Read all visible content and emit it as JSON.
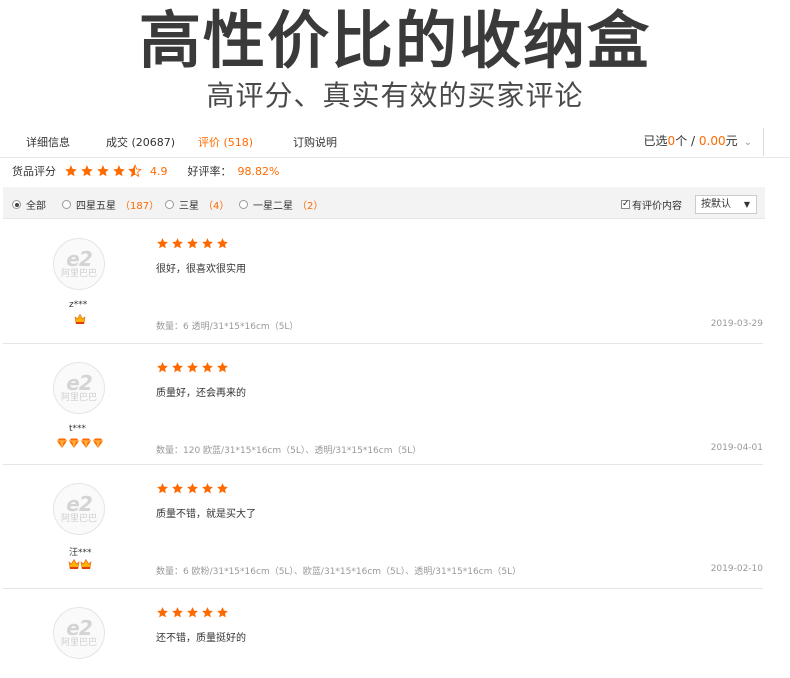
{
  "banner": {
    "title": "高性价比的收纳盒",
    "subtitle": "高评分、真实有效的买家评论"
  },
  "tabs": [
    {
      "label": "详细信息",
      "active": false
    },
    {
      "label": "成交 (20687)",
      "active": false
    },
    {
      "label": "评价 (518)",
      "active": true
    },
    {
      "label": "订购说明",
      "active": false
    }
  ],
  "selection": {
    "prefix": "已选",
    "count": "0",
    "unit": "个 / ",
    "amount": "0.00",
    "currency": "元"
  },
  "rating": {
    "label": "货品评分",
    "score": "4.9",
    "score_value": 4.5,
    "good_rate_label": "好评率：",
    "good_rate": "98.82%"
  },
  "filters": [
    {
      "label": "全部",
      "count": "",
      "checked": true
    },
    {
      "label": "四星五星",
      "count": "（187）",
      "checked": false
    },
    {
      "label": "三星",
      "count": "（4）",
      "checked": false
    },
    {
      "label": "一星二星",
      "count": "（2）",
      "checked": false
    }
  ],
  "has_content_filter": {
    "label": "有评价内容",
    "checked": true
  },
  "sort": {
    "selected": "按默认"
  },
  "colors": {
    "accent": "#ff6a00",
    "star": "#ff6a00",
    "muted": "#999999"
  },
  "reviews": [
    {
      "user": "z***",
      "badge_type": "crown",
      "badge_count": 1,
      "stars": 5,
      "text": "很好，很喜欢很实用",
      "meta": "数量：6   透明/31*15*16cm（5L）",
      "date": "2019-03-29"
    },
    {
      "user": "t***",
      "badge_type": "diamond",
      "badge_count": 4,
      "stars": 5,
      "text": "质量好，还会再来的",
      "meta": "数量：120   欧蓝/31*15*16cm（5L）、透明/31*15*16cm（5L）",
      "date": "2019-04-01"
    },
    {
      "user": "汪***",
      "badge_type": "crown",
      "badge_count": 2,
      "stars": 5,
      "text": "质量不错，就是买大了",
      "meta": "数量：6   欧粉/31*15*16cm（5L）、欧蓝/31*15*16cm（5L）、透明/31*15*16cm（5L）",
      "date": "2019-02-10"
    },
    {
      "user": "",
      "badge_type": "",
      "badge_count": 0,
      "stars": 5,
      "text": "还不错，质量挺好的",
      "meta": "",
      "date": ""
    }
  ],
  "avatar_logo": {
    "mark": "e2",
    "text": "阿里巴巴"
  }
}
